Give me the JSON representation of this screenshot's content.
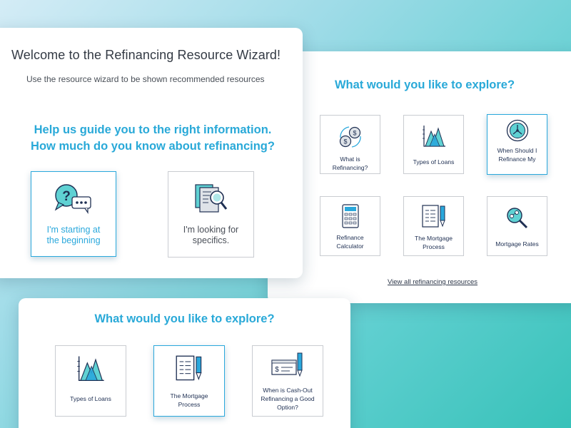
{
  "wizard": {
    "title": "Welcome to the Refinancing Resource Wizard!",
    "subtitle": "Use the resource wizard to be shown recommended resources",
    "question_line1": "Help us guide you to the right information.",
    "question_line2": "How much do you know about refinancing?",
    "options": [
      {
        "line1": "I'm starting at",
        "line2": "the beginning",
        "icon": "question-chat-icon",
        "selected": true
      },
      {
        "line1": "I'm looking for",
        "line2": "specifics.",
        "icon": "document-magnifier-icon",
        "selected": false
      }
    ]
  },
  "explore": {
    "heading": "What would you like to explore?",
    "tiles": [
      {
        "line1": "What is",
        "line2": "Refinancing?",
        "icon": "coins-exchange-icon"
      },
      {
        "line1": "Types of Loans",
        "line2": "",
        "icon": "mountain-chart-icon"
      },
      {
        "line1": "When Should I",
        "line2": "Refinance My",
        "icon": "clock-icon",
        "selected": true
      },
      {
        "line1": "Refinance",
        "line2": "Calculator",
        "icon": "calculator-icon"
      },
      {
        "line1": "The Mortgage",
        "line2": "Process",
        "icon": "document-pen-icon"
      },
      {
        "line1": "Mortgage Rates",
        "line2": "",
        "icon": "magnifier-icon"
      }
    ],
    "view_all_link": "View all refinancing resources"
  },
  "explore_bottom": {
    "heading": "What would you like to explore?",
    "tiles": [
      {
        "line1": "Types of Loans",
        "line2": "",
        "line3": "",
        "icon": "mountain-chart-icon"
      },
      {
        "line1": "The Mortgage",
        "line2": "Process",
        "line3": "",
        "icon": "document-pen-icon",
        "selected": true
      },
      {
        "line1": "When is Cash-Out",
        "line2": "Refinancing a Good",
        "line3": "Option?",
        "icon": "check-pen-icon"
      }
    ]
  },
  "colors": {
    "accent": "#2aa8dc",
    "text_dark": "#1e2f52",
    "border": "#c9ccd1",
    "background_start": "#d4ecf6",
    "background_end": "#38c2b9"
  }
}
